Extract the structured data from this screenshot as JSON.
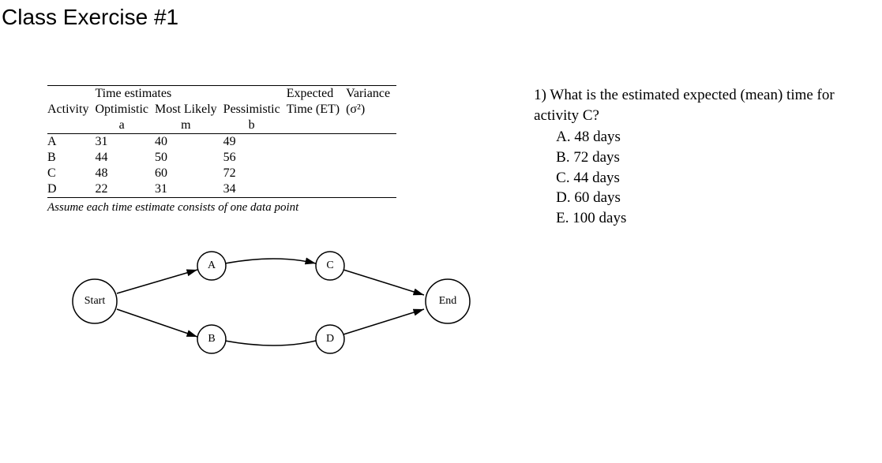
{
  "title": "Class Exercise #1",
  "table": {
    "group_header": "Time estimates",
    "headers": {
      "activity": "Activity",
      "optimistic": "Optimistic",
      "most_likely": "Most Likely",
      "pessimistic": "Pessimistic",
      "expected": "Expected Time (ET)",
      "variance": "Variance (σ²)"
    },
    "subheaders": {
      "a": "a",
      "m": "m",
      "b": "b"
    },
    "rows": [
      {
        "activity": "A",
        "a": "31",
        "m": "40",
        "b": "49"
      },
      {
        "activity": "B",
        "a": "44",
        "m": "50",
        "b": "56"
      },
      {
        "activity": "C",
        "a": "48",
        "m": "60",
        "b": "72"
      },
      {
        "activity": "D",
        "a": "22",
        "m": "31",
        "b": "34"
      }
    ],
    "note": "Assume each time estimate consists of one data point"
  },
  "diagram": {
    "nodes": {
      "start": "Start",
      "a": "A",
      "b": "B",
      "c": "C",
      "d": "D",
      "end": "End"
    }
  },
  "question": {
    "text": "1) What is the estimated expected (mean) time for activity C?",
    "options": {
      "a": "A. 48 days",
      "b": "B. 72 days",
      "c": "C. 44 days",
      "d": "D. 60 days",
      "e": "E. 100 days"
    }
  },
  "chart_data": {
    "type": "table",
    "title": "PERT Time Estimates",
    "columns": [
      "Activity",
      "Optimistic (a)",
      "Most Likely (m)",
      "Pessimistic (b)"
    ],
    "rows": [
      [
        "A",
        31,
        40,
        49
      ],
      [
        "B",
        44,
        50,
        56
      ],
      [
        "C",
        48,
        60,
        72
      ],
      [
        "D",
        22,
        31,
        34
      ]
    ],
    "network": {
      "nodes": [
        "Start",
        "A",
        "B",
        "C",
        "D",
        "End"
      ],
      "edges": [
        [
          "Start",
          "A"
        ],
        [
          "Start",
          "B"
        ],
        [
          "A",
          "C"
        ],
        [
          "B",
          "D"
        ],
        [
          "C",
          "End"
        ],
        [
          "D",
          "End"
        ]
      ]
    }
  }
}
